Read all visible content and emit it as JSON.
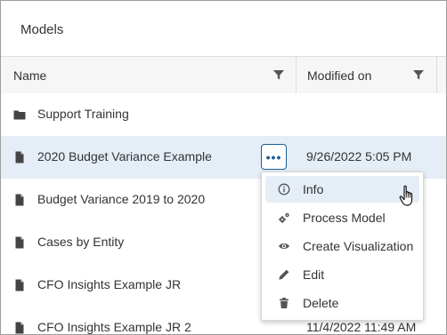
{
  "panel": {
    "title": "Models"
  },
  "table": {
    "columns": [
      {
        "label": "Name"
      },
      {
        "label": "Modified on"
      }
    ],
    "rows": [
      {
        "icon": "folder-icon",
        "name": "Support Training",
        "modified": ""
      },
      {
        "icon": "document-icon",
        "name": "2020 Budget Variance Example",
        "modified": "9/26/2022 5:05 PM",
        "selected": true
      },
      {
        "icon": "document-icon",
        "name": "Budget Variance 2019 to 2020",
        "modified": ""
      },
      {
        "icon": "document-icon",
        "name": "Cases by Entity",
        "modified": ""
      },
      {
        "icon": "document-icon",
        "name": "CFO Insights Example JR",
        "modified": ""
      },
      {
        "icon": "document-icon",
        "name": "CFO Insights Example JR 2",
        "modified": "11/4/2022 11:49 AM"
      }
    ]
  },
  "more_button": {
    "label": "•••"
  },
  "context_menu": {
    "items": [
      {
        "icon": "info-icon",
        "label": "Info",
        "hovered": true
      },
      {
        "icon": "gears-icon",
        "label": "Process Model"
      },
      {
        "icon": "eye-icon",
        "label": "Create Visualization"
      },
      {
        "icon": "pencil-icon",
        "label": "Edit"
      },
      {
        "icon": "trash-icon",
        "label": "Delete"
      }
    ]
  },
  "colors": {
    "accent": "#1f5f96",
    "selected_row": "#e5eef7",
    "header_bg": "#f6f6f6",
    "icon": "#555555"
  }
}
